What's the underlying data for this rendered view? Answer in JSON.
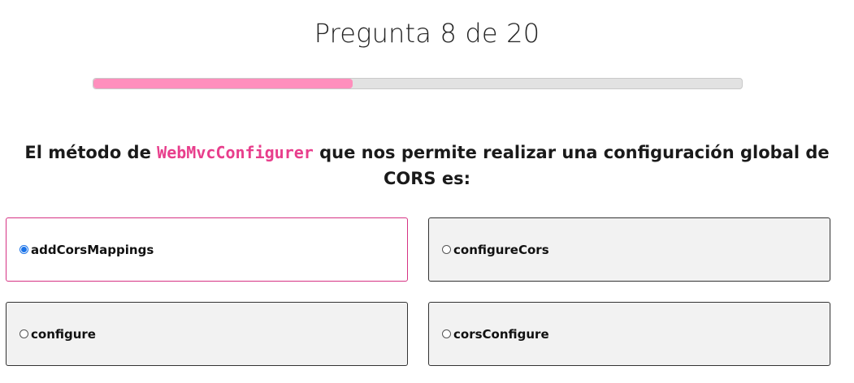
{
  "header": {
    "title": "Pregunta 8 de 20"
  },
  "progress": {
    "current": 8,
    "total": 20,
    "fraction": 0.4,
    "fill_color": "#ff8fbd",
    "track_color": "#e2e2e2"
  },
  "question": {
    "prefix": "El método de ",
    "code": "WebMvcConfigurer",
    "suffix": " que nos permite realizar una configuración global de CORS es:",
    "code_color": "#e83e8c"
  },
  "options": [
    {
      "label": "addCorsMappings",
      "selected": true
    },
    {
      "label": "configureCors",
      "selected": false
    },
    {
      "label": "configure",
      "selected": false
    },
    {
      "label": "corsConfigure",
      "selected": false
    }
  ],
  "colors": {
    "selected_border": "#d63384",
    "radio_checked": "#1a73e8",
    "option_bg": "#f2f2f2"
  }
}
